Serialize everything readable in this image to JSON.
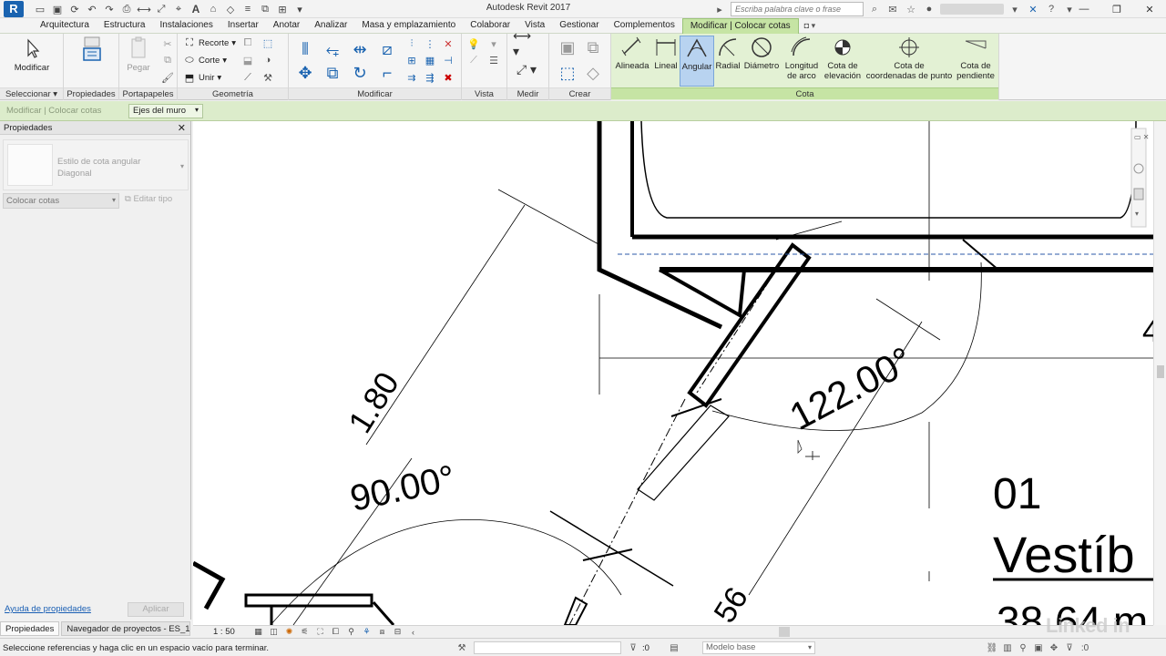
{
  "app": {
    "title": "Autodesk Revit 2017",
    "logo_letter": "R"
  },
  "search": {
    "placeholder": "Escriba palabra clave o frase"
  },
  "tabs": [
    {
      "label": "Arquitectura"
    },
    {
      "label": "Estructura"
    },
    {
      "label": "Instalaciones"
    },
    {
      "label": "Insertar"
    },
    {
      "label": "Anotar"
    },
    {
      "label": "Analizar"
    },
    {
      "label": "Masa y emplazamiento"
    },
    {
      "label": "Colaborar"
    },
    {
      "label": "Vista"
    },
    {
      "label": "Gestionar"
    },
    {
      "label": "Complementos"
    },
    {
      "label": "Modificar | Colocar cotas"
    }
  ],
  "ribbon": {
    "seleccionar": {
      "modify_label": "Modificar",
      "panel": "Seleccionar"
    },
    "propiedades": {
      "panel": "Propiedades"
    },
    "portapapeles": {
      "paste_label": "Pegar",
      "panel": "Portapapeles"
    },
    "geometria": {
      "recorte": "Recorte",
      "corte": "Corte",
      "unir": "Unir",
      "panel": "Geometría"
    },
    "modificar": {
      "panel": "Modificar"
    },
    "vista": {
      "panel": "Vista"
    },
    "medir": {
      "panel": "Medir"
    },
    "crear": {
      "panel": "Crear"
    },
    "cota": {
      "panel": "Cota",
      "buttons": [
        {
          "line1": "Alineada",
          "line2": ""
        },
        {
          "line1": "Lineal",
          "line2": ""
        },
        {
          "line1": "Angular",
          "line2": ""
        },
        {
          "line1": "Radial",
          "line2": ""
        },
        {
          "line1": "Diámetro",
          "line2": ""
        },
        {
          "line1": "Longitud",
          "line2": "de arco"
        },
        {
          "line1": "Cota de",
          "line2": "elevación"
        },
        {
          "line1": "Cota de",
          "line2": "coordenadas de punto"
        },
        {
          "line1": "Cota de",
          "line2": "pendiente"
        }
      ]
    }
  },
  "options_bar": {
    "context": "Modificar | Colocar cotas",
    "reference": "Ejes del muro"
  },
  "properties": {
    "title": "Propiedades",
    "type_line1": "Estilo de cota angular",
    "type_line2": "Diagonal",
    "instance_filter": "Colocar cotas",
    "edit_type": "Editar tipo",
    "help_link": "Ayuda de propiedades",
    "apply": "Aplicar"
  },
  "bottom_tabs": [
    {
      "label": "Propiedades"
    },
    {
      "label": "Navegador de proyectos - ES_1..."
    }
  ],
  "drawing": {
    "dim_angle_1": "122.00°",
    "dim_angle_2": "90.00°",
    "dim_len_1": "1.80",
    "dim_len_2": "56",
    "room_number": "01",
    "room_name": "Vestíb",
    "room_area": "38.64 m",
    "partial_text": "4"
  },
  "view_bar": {
    "scale": "1 : 50"
  },
  "status": {
    "message": "Seleccione referencias y haga clic en un espacio vacío para terminar.",
    "selected_count": ":0",
    "model": "Modelo base"
  },
  "watermark": "Linked in",
  "colors": {
    "context_tab": "#c6e4a4",
    "options_bar": "#dceccb",
    "revit_blue": "#1a63b0"
  }
}
